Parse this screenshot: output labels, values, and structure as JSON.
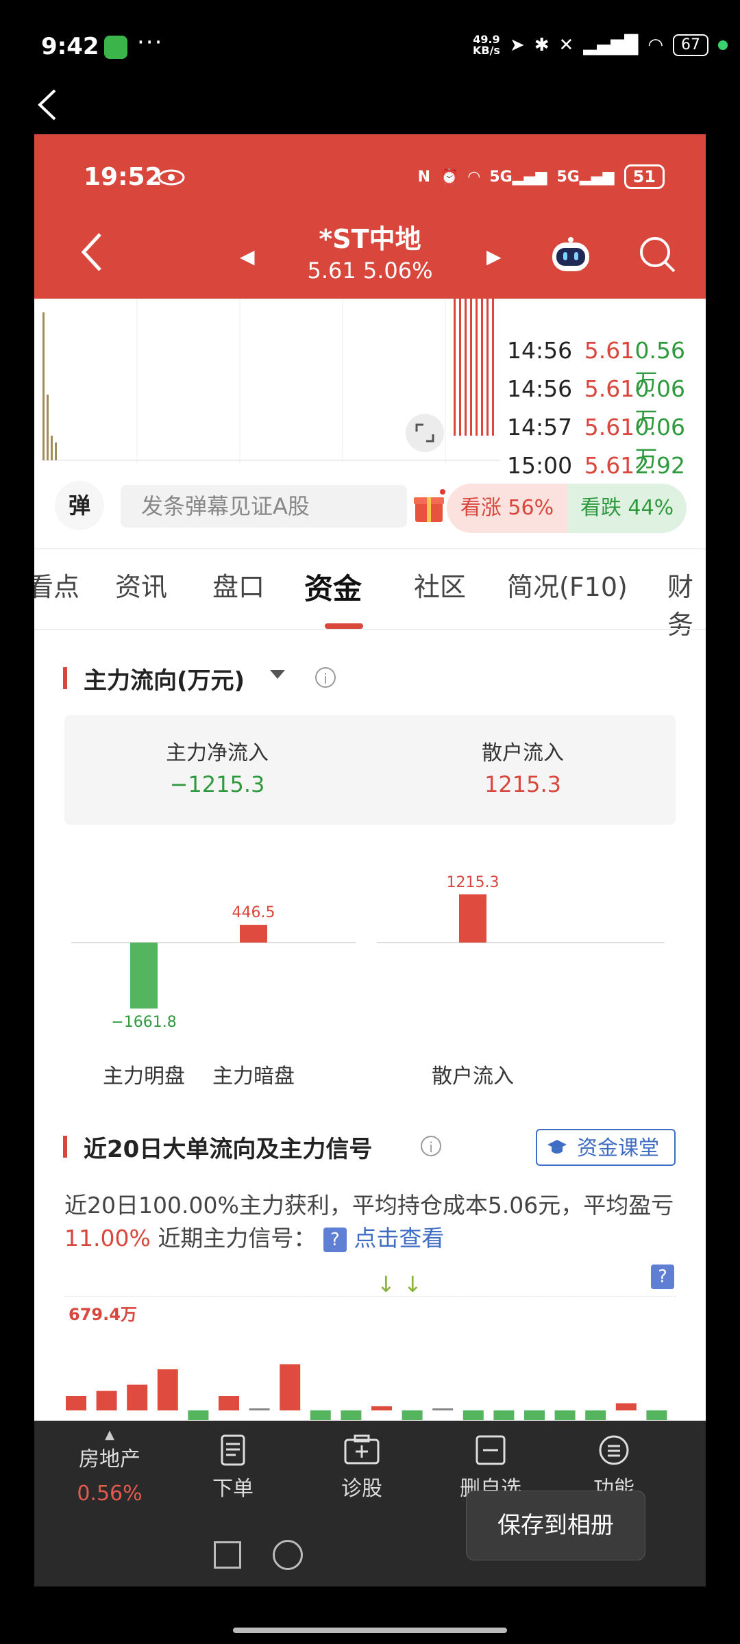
{
  "os": {
    "time": "9:42",
    "dots": "···",
    "net_speed_top": "49.9",
    "net_speed_unit": "KB/s",
    "battery": "67"
  },
  "inner_status": {
    "time": "19:52",
    "battery": "51"
  },
  "stock": {
    "name": "*ST中地",
    "price_change": "5.61 5.06%"
  },
  "ticks": [
    {
      "time": "14:56",
      "price": "5.61",
      "vol": "0.56万"
    },
    {
      "time": "14:56",
      "price": "5.61",
      "vol": "0.06万"
    },
    {
      "time": "14:57",
      "price": "5.61",
      "vol": "0.06万"
    },
    {
      "time": "15:00",
      "price": "5.61",
      "vol": "2.92万"
    }
  ],
  "danmu": {
    "badge": "弹",
    "placeholder": "发条弹幕见证A股"
  },
  "vote": {
    "up": "看涨 56%",
    "down": "看跌 44%"
  },
  "tabs": [
    "看点",
    "资讯",
    "盘口",
    "资金",
    "社区",
    "简况(F10)",
    "财务"
  ],
  "active_tab": "资金",
  "main_flow": {
    "title": "主力流向(万元)",
    "net_label": "主力净流入",
    "net_value": "−1215.3",
    "retail_label": "散户流入",
    "retail_value": "1215.3"
  },
  "chart_data": {
    "type": "bar",
    "categories": [
      "主力明盘",
      "主力暗盘",
      "散户流入"
    ],
    "values": [
      -1661.8,
      446.5,
      1215.3
    ],
    "value_labels": [
      "−1661.8",
      "446.5",
      "1215.3"
    ],
    "colors": [
      "#55b55f",
      "#e04b3f",
      "#e04b3f"
    ]
  },
  "signal": {
    "title": "近20日大单流向及主力信号",
    "button": "资金课堂",
    "desc_prefix": "近20日100.00%主力获利，平均持仓成本5.06元，平均盈亏",
    "desc_pct": "11.00%",
    "desc_suffix": " 近期主力信号：",
    "q": "?",
    "link": "点击查看",
    "arrows": "↓↓",
    "max_label": "679.4万",
    "bars": [
      {
        "v": 0.14,
        "c": "#e04b3f"
      },
      {
        "v": 0.19,
        "c": "#e04b3f"
      },
      {
        "v": 0.25,
        "c": "#e04b3f"
      },
      {
        "v": 0.4,
        "c": "#e04b3f"
      },
      {
        "v": -0.1,
        "c": "#55b55f"
      },
      {
        "v": 0.14,
        "c": "#e04b3f"
      },
      {
        "v": 0.01,
        "c": "#888888"
      },
      {
        "v": 0.45,
        "c": "#e04b3f"
      },
      {
        "v": -0.1,
        "c": "#55b55f"
      },
      {
        "v": -0.1,
        "c": "#55b55f"
      },
      {
        "v": 0.04,
        "c": "#e04b3f"
      },
      {
        "v": -0.1,
        "c": "#55b55f"
      },
      {
        "v": 0.01,
        "c": "#888888"
      },
      {
        "v": -0.1,
        "c": "#55b55f"
      },
      {
        "v": -0.1,
        "c": "#55b55f"
      },
      {
        "v": -0.1,
        "c": "#55b55f"
      },
      {
        "v": -0.1,
        "c": "#55b55f"
      },
      {
        "v": -0.1,
        "c": "#55b55f"
      },
      {
        "v": 0.07,
        "c": "#e04b3f"
      },
      {
        "v": -0.1,
        "c": "#55b55f"
      }
    ]
  },
  "bottom_nav": {
    "sector": "房地产",
    "sector_pct": "0.56%",
    "order": "下单",
    "diagnose": "诊股",
    "remove_watch": "删自选",
    "functions": "功能"
  },
  "toast": "保存到相册"
}
